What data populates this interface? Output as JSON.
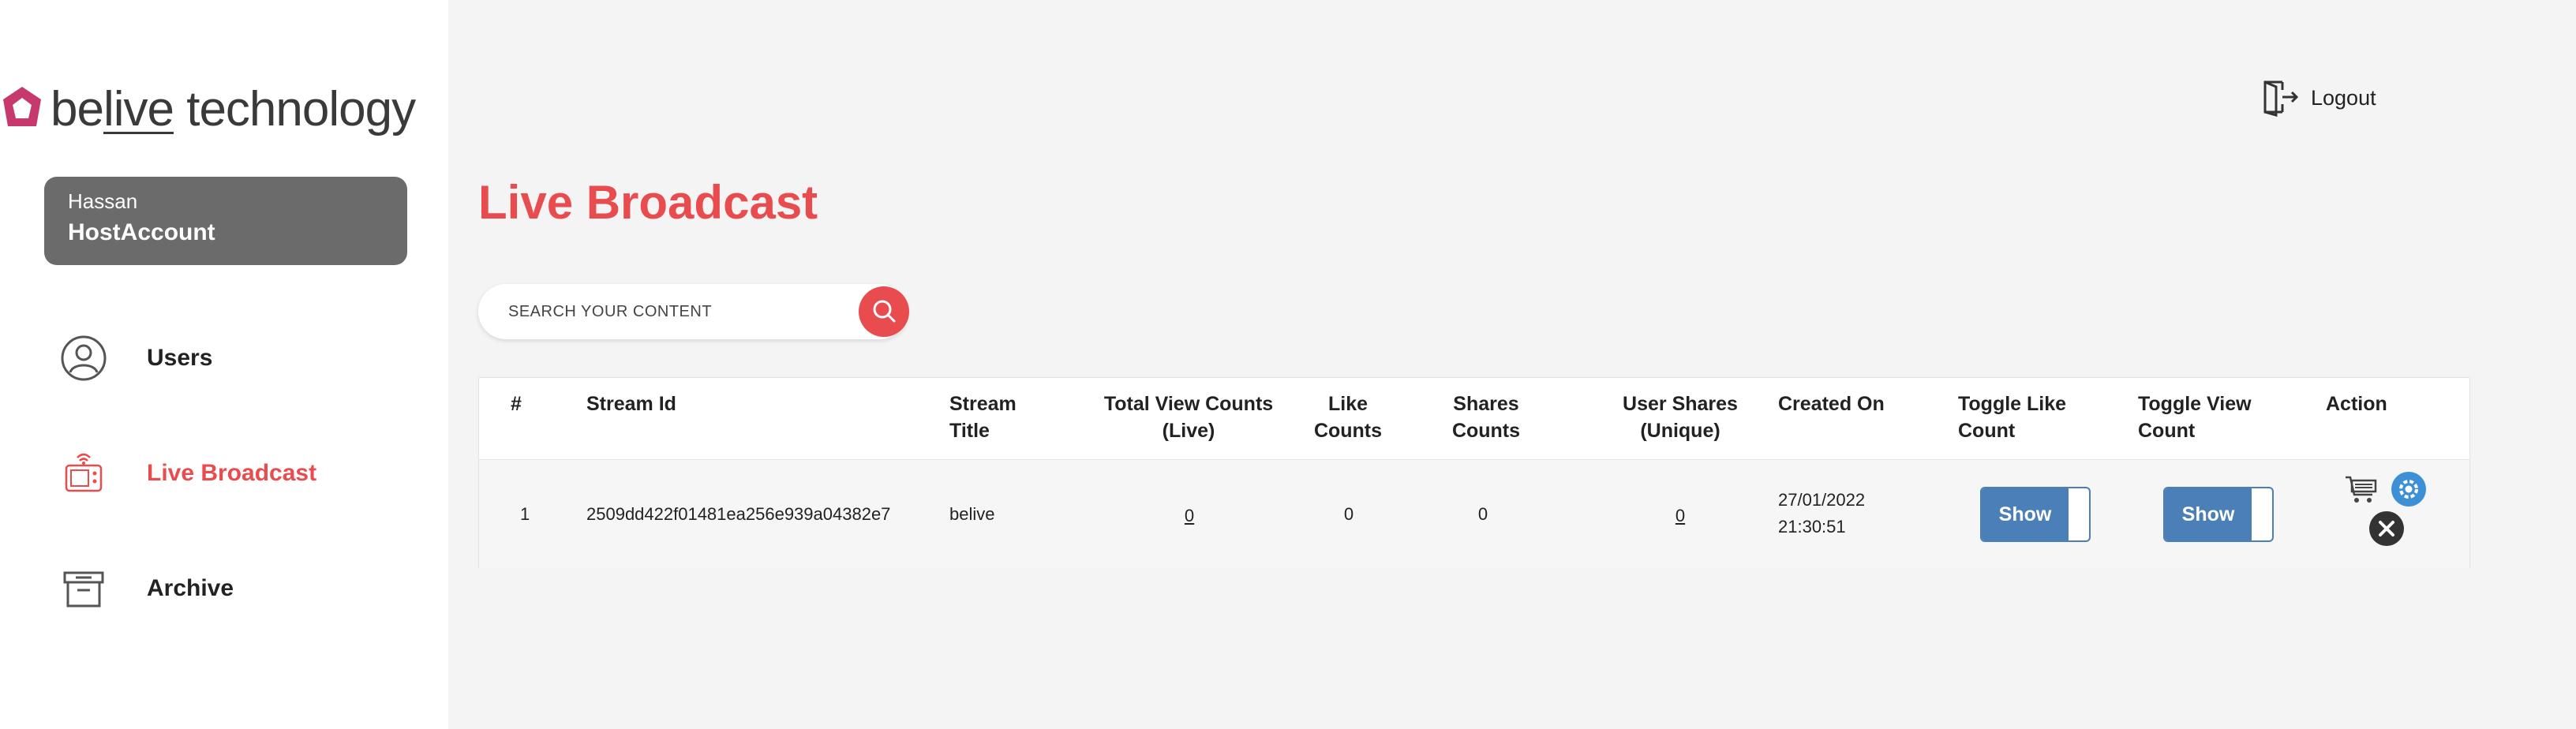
{
  "brand": {
    "logo_alt": "belive technology",
    "text_part1": "be",
    "text_part2": "live",
    "text_part3": " technology",
    "logo_color": "#c7396c"
  },
  "user": {
    "name": "Hassan",
    "account": "HostAccount"
  },
  "nav": {
    "items": [
      {
        "label": "Users",
        "icon": "user-circle-icon",
        "active": false
      },
      {
        "label": "Live Broadcast",
        "icon": "broadcast-icon",
        "active": true
      },
      {
        "label": "Archive",
        "icon": "archive-box-icon",
        "active": false
      }
    ]
  },
  "header": {
    "logout_label": "Logout"
  },
  "page": {
    "title": "Live Broadcast"
  },
  "search": {
    "placeholder": "SEARCH YOUR CONTENT",
    "value": ""
  },
  "table": {
    "columns": [
      {
        "label": "#"
      },
      {
        "label": "Stream Id"
      },
      {
        "label": "Stream Title"
      },
      {
        "label": "Total View Counts (Live)"
      },
      {
        "label": "Like Counts"
      },
      {
        "label": "Shares Counts"
      },
      {
        "label": "User Shares (Unique)"
      },
      {
        "label": "Created On"
      },
      {
        "label": "Toggle Like Count"
      },
      {
        "label": "Toggle View Count"
      },
      {
        "label": "Action"
      }
    ],
    "rows": [
      {
        "index": "1",
        "stream_id": "2509dd422f01481ea256e939a04382e7",
        "stream_title": "belive",
        "total_view_counts": "0",
        "like_counts": "0",
        "shares_counts": "0",
        "user_shares": "0",
        "created_on": "27/01/2022 21:30:51",
        "toggle_like_label": "Show",
        "toggle_view_label": "Show"
      }
    ]
  },
  "colors": {
    "accent": "#e84c4f",
    "toggle_blue": "#4a7fb8",
    "user_card": "#6b6b6b",
    "gear_blue": "#3d8fd6"
  }
}
